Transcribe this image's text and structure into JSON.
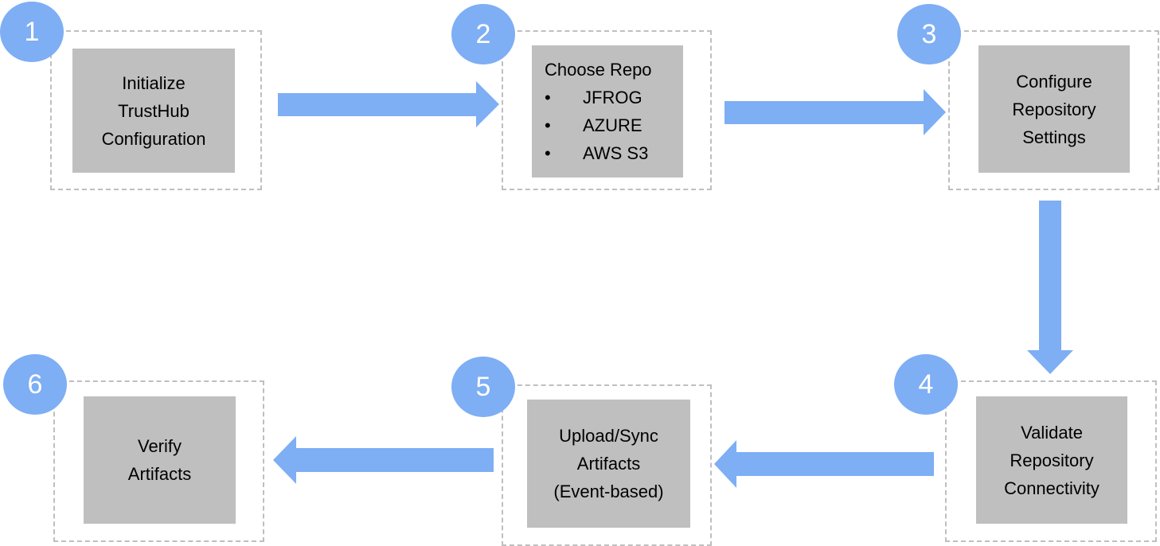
{
  "colors": {
    "arrow": "#7EAEF4",
    "box": "#BFBFBF",
    "dash": "#BFBFBF"
  },
  "steps": [
    {
      "number": "1",
      "lines": [
        "Initialize",
        "TrustHub",
        "Configuration"
      ]
    },
    {
      "number": "2",
      "title": "Choose Repo",
      "items": [
        "JFROG",
        "AZURE",
        "AWS S3"
      ]
    },
    {
      "number": "3",
      "lines": [
        "Configure",
        "Repository",
        "Settings"
      ]
    },
    {
      "number": "4",
      "lines": [
        "Validate",
        "Repository",
        "Connectivity"
      ]
    },
    {
      "number": "5",
      "lines": [
        "Upload/Sync",
        "Artifacts",
        "(Event-based)"
      ]
    },
    {
      "number": "6",
      "lines": [
        "Verify",
        "Artifacts"
      ]
    }
  ]
}
